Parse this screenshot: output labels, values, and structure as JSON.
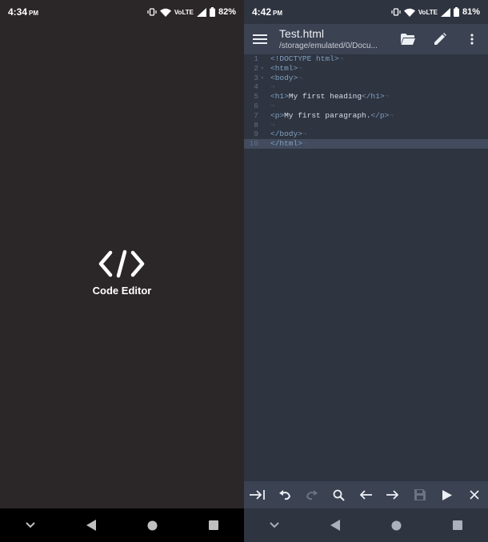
{
  "left_screen": {
    "status": {
      "time": "4:34",
      "ampm": "PM",
      "volte": "VoLTE",
      "battery": "82%"
    },
    "splash": {
      "app_name": "Code Editor",
      "logo_icon": "code-brackets-icon"
    }
  },
  "right_screen": {
    "status": {
      "time": "4:42",
      "ampm": "PM",
      "volte": "VoLTE",
      "battery": "81%"
    },
    "toolbar": {
      "title": "Test.html",
      "path": "/storage/emulated/0/Docu...",
      "icons": [
        "menu-icon",
        "folder-open-icon",
        "edit-pencil-icon",
        "more-vert-icon"
      ]
    },
    "editor": {
      "active_line": 10,
      "lines": [
        {
          "n": "1",
          "fold": "",
          "code": "<!DOCTYPE html>"
        },
        {
          "n": "2",
          "fold": "▾",
          "code": "<html>"
        },
        {
          "n": "3",
          "fold": "▾",
          "code": "<body>"
        },
        {
          "n": "4",
          "fold": "",
          "code": ""
        },
        {
          "n": "5",
          "fold": "",
          "code": "<h1>My first heading</h1>"
        },
        {
          "n": "6",
          "fold": "",
          "code": ""
        },
        {
          "n": "7",
          "fold": "",
          "code": "<p>My first paragraph.</p>"
        },
        {
          "n": "8",
          "fold": "",
          "code": ""
        },
        {
          "n": "9",
          "fold": "",
          "code": "</body>"
        },
        {
          "n": "10",
          "fold": "",
          "code": "</html>"
        }
      ]
    },
    "actions": [
      "tab-indent-icon",
      "undo-icon",
      "redo-icon",
      "search-icon",
      "arrow-left-icon",
      "arrow-right-icon",
      "save-icon",
      "play-icon",
      "close-icon"
    ]
  },
  "colors": {
    "splash_bg": "#2b2627",
    "editor_bg": "#2e3440",
    "toolbar_bg": "#3b4252",
    "tag": "#81a1c1",
    "text": "#d8dee9",
    "line_number": "#616e88",
    "active_line": "#434c5e"
  }
}
